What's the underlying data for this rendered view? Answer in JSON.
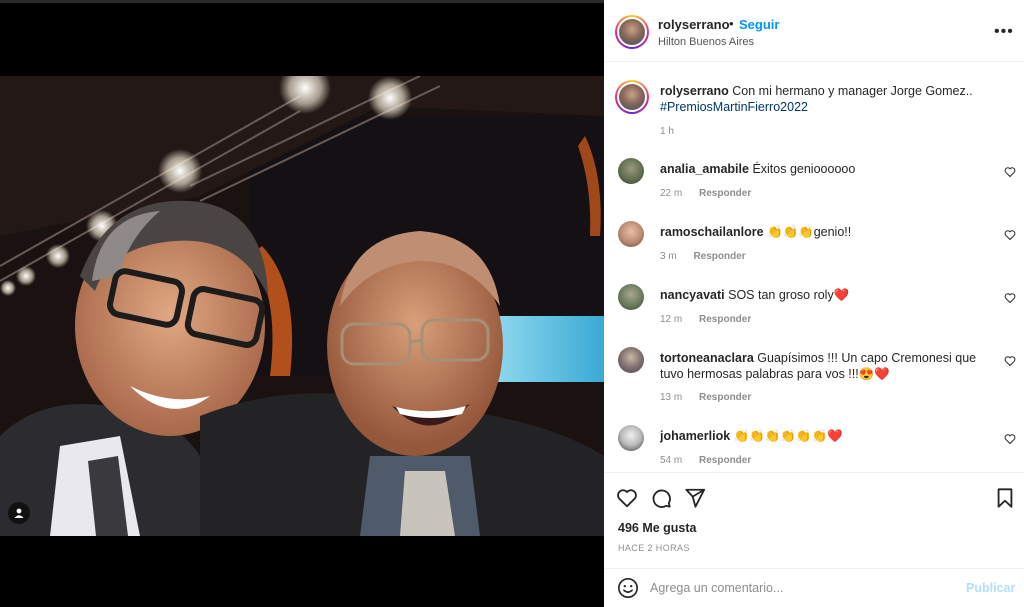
{
  "post": {
    "username": "rolyserrano",
    "separator": "•",
    "follow_label": "Seguir",
    "location": "Hilton Buenos Aires",
    "more_label": "•••"
  },
  "caption": {
    "username": "rolyserrano",
    "text": "Con mi hermano y manager Jorge Gomez..",
    "hashtag": "#PremiosMartinFierro2022",
    "time": "1 h"
  },
  "comments": [
    {
      "username": "analia_amabile",
      "text": "Éxitos genioooooo",
      "time": "22 m",
      "reply_label": "Responder"
    },
    {
      "username": "ramoschailanlore",
      "emoji": "👏👏👏",
      "text": "genio!!",
      "time": "3 m",
      "reply_label": "Responder"
    },
    {
      "username": "nancyavati",
      "text": "SOS tan groso roly",
      "emoji": "❤️",
      "time": "12 m",
      "reply_label": "Responder"
    },
    {
      "username": "tortoneanaclara",
      "text": "Guapísimos !!! Un capo Cremonesi que tuvo hermosas palabras para vos !!!",
      "emoji": "😍❤️",
      "time": "13 m",
      "reply_label": "Responder"
    },
    {
      "username": "johamerliok",
      "emoji": "👏👏👏👏👏👏",
      "emoji2": "❤️",
      "time": "54 m",
      "reply_label": "Responder"
    }
  ],
  "stats": {
    "likes": "496 Me gusta",
    "ago": "HACE 2 HORAS"
  },
  "add_comment": {
    "placeholder": "Agrega un comentario...",
    "post_label": "Publicar"
  },
  "colors": {
    "accent": "#0095f6",
    "hashtag": "#00376b",
    "muted": "#8e8e8e",
    "post_disabled": "#b2dffc"
  }
}
